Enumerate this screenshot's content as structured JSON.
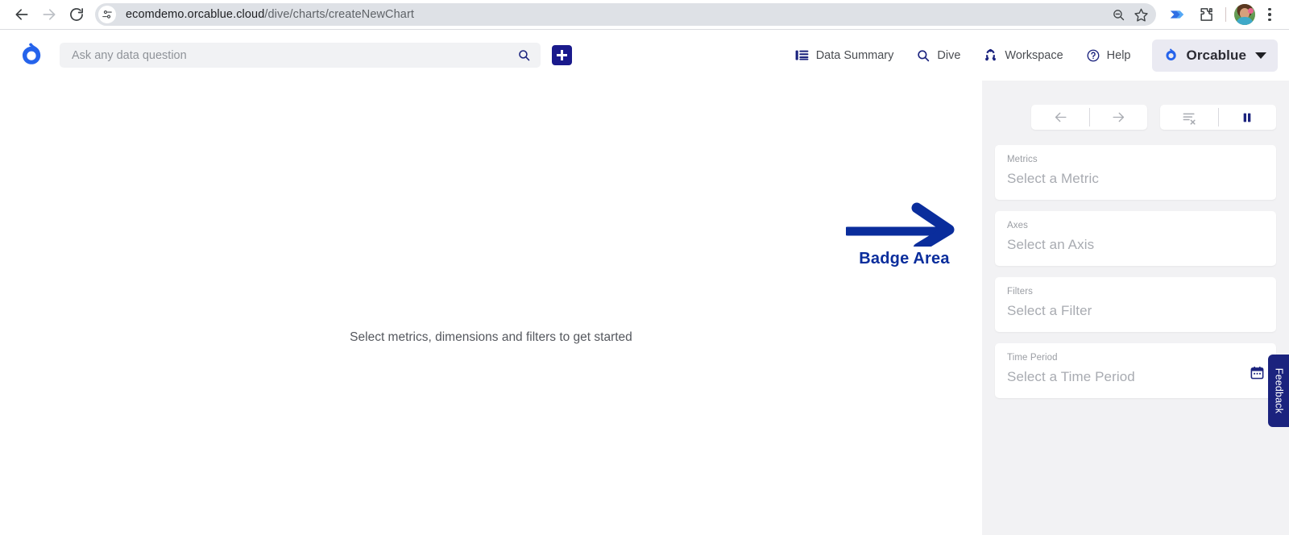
{
  "browser": {
    "back_icon": "arrow-left-icon",
    "forward_icon": "arrow-right-icon",
    "reload_icon": "reload-icon",
    "site_settings_icon": "tune-sliders-icon",
    "url": "ecomdemo.orcablue.cloud/dive/charts/createNewChart",
    "url_host": "ecomdemo.orcablue.cloud",
    "url_path": "/dive/charts/createNewChart",
    "zoom_out_icon": "zoom-out-icon",
    "bookmark_icon": "star-icon",
    "extension_power_icon": "power-automate-icon",
    "extensions_icon": "puzzle-piece-icon",
    "profile_icon": "profile-avatar",
    "menu_icon": "three-dots-vertical-icon"
  },
  "header": {
    "logo_icon": "orcablue-logo-icon",
    "search": {
      "placeholder": "Ask any data question",
      "value": "",
      "search_icon": "search-icon"
    },
    "add_button_label": "+",
    "add_button_icon": "plus-icon",
    "nav": [
      {
        "label": "Data Summary",
        "icon": "list-lines-icon"
      },
      {
        "label": "Dive",
        "icon": "magnifier-icon"
      },
      {
        "label": "Workspace",
        "icon": "workspace-nodes-icon"
      },
      {
        "label": "Help",
        "icon": "question-circle-icon"
      }
    ],
    "workspace": {
      "name": "Orcablue",
      "logo_icon": "orcablue-logo-icon",
      "caret_icon": "chevron-down-icon"
    }
  },
  "canvas": {
    "empty_message": "Select metrics, dimensions and filters to get started",
    "annotation": {
      "label": "Badge Area",
      "arrow_icon": "arrow-right-annotation-icon",
      "color": "#0a2d9c"
    }
  },
  "panel": {
    "toolbar": [
      {
        "name": "undo",
        "icon": "arrow-left-icon",
        "color": "#a9acb2"
      },
      {
        "name": "redo",
        "icon": "arrow-right-icon",
        "color": "#a9acb2"
      },
      {
        "name": "clear-filters",
        "icon": "clear-filter-icon",
        "color": "#a9acb2"
      },
      {
        "name": "pause",
        "icon": "pause-icon",
        "color": "#1b237e"
      }
    ],
    "cards": [
      {
        "label": "Metrics",
        "placeholder": "Select a Metric",
        "icon": null
      },
      {
        "label": "Axes",
        "placeholder": "Select an Axis",
        "icon": null
      },
      {
        "label": "Filters",
        "placeholder": "Select a Filter",
        "icon": null
      },
      {
        "label": "Time Period",
        "placeholder": "Select a Time Period",
        "icon": "calendar-icon"
      }
    ]
  },
  "feedback": {
    "label": "Feedback",
    "color": "#1b237e"
  },
  "colors": {
    "brand_blue": "#2563eb",
    "navy": "#1b237e",
    "annotation_navy": "#0a2d9c",
    "panel_bg": "#f2f2f4",
    "omnibox_bg": "#dee1e6"
  }
}
